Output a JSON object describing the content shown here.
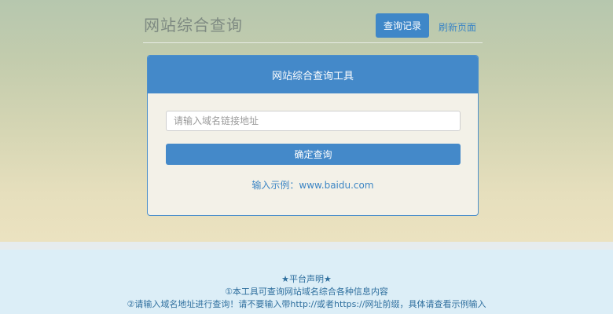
{
  "header": {
    "site_title": "网站综合查询",
    "history_button": "查询记录",
    "refresh_link": "刷新页面"
  },
  "tool": {
    "title": "网站综合查询工具",
    "input_placeholder": "请输入域名链接地址",
    "input_value": "",
    "submit_label": "确定查询",
    "example_text": "输入示例：www.baidu.com"
  },
  "notice": {
    "title": "★平台声明★",
    "line1": "①本工具可查询网站域名综合各种信息内容",
    "line2": "②请输入域名地址进行查询！请不要输入带http://或者https://网址前缀，具体请查看示例输入"
  },
  "colors": {
    "primary": "#4489c9",
    "link": "#3c86c5",
    "notice_text": "#2f6f9e"
  }
}
